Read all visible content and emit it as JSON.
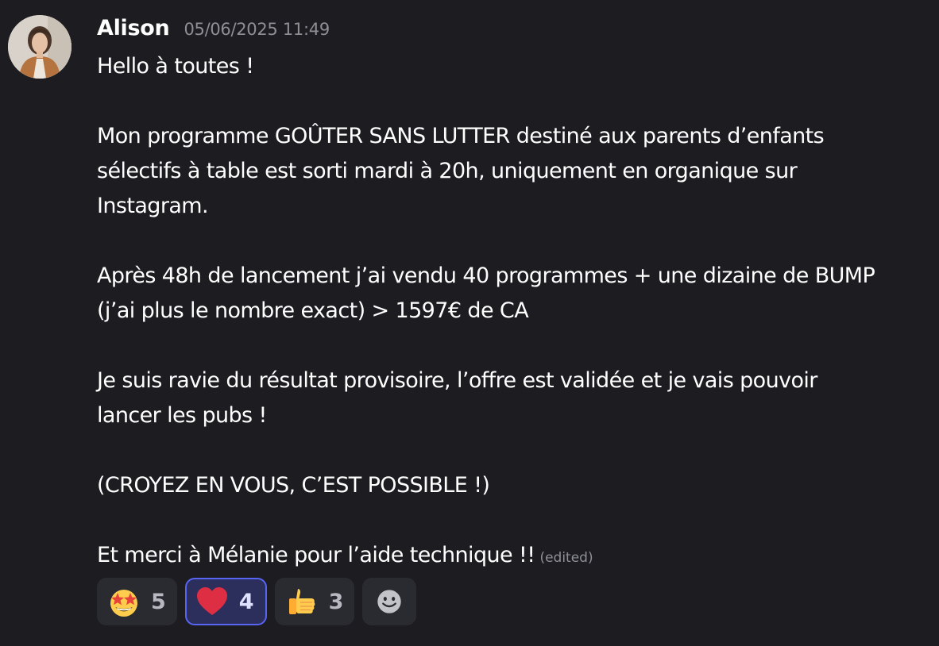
{
  "message": {
    "author": "Alison",
    "timestamp": "05/06/2025 11:49",
    "avatar_icon": "user-avatar",
    "lines": [
      "Hello à toutes !",
      "",
      "Mon programme GOÛTER SANS LUTTER destiné aux parents d’enfants",
      "sélectifs à table est sorti mardi à 20h, uniquement en organique sur",
      "Instagram.",
      "",
      "Après 48h de lancement j’ai vendu 40 programmes + une dizaine de BUMP",
      "(j’ai plus le nombre exact) > 1597€ de CA",
      "",
      "Je suis ravie du résultat provisoire, l’offre est validée et je vais pouvoir",
      "lancer les pubs !",
      "",
      "(CROYEZ EN VOUS, C’EST POSSIBLE !)",
      "",
      "Et merci à Mélanie pour l’aide technique !!"
    ],
    "edited_label": "(edited)"
  },
  "reactions": [
    {
      "emoji": "star-struck-icon",
      "count": "5",
      "active": false
    },
    {
      "emoji": "red-heart-icon",
      "count": "4",
      "active": true
    },
    {
      "emoji": "thumbs-up-icon",
      "count": "3",
      "active": false
    }
  ],
  "add_reaction_icon": "add-reaction-smiley-icon",
  "colors": {
    "background": "#1c1c21",
    "text": "#ffffff",
    "muted": "#8e8f96",
    "reaction_bg": "#2a2a31",
    "active_border": "#5865f2"
  }
}
